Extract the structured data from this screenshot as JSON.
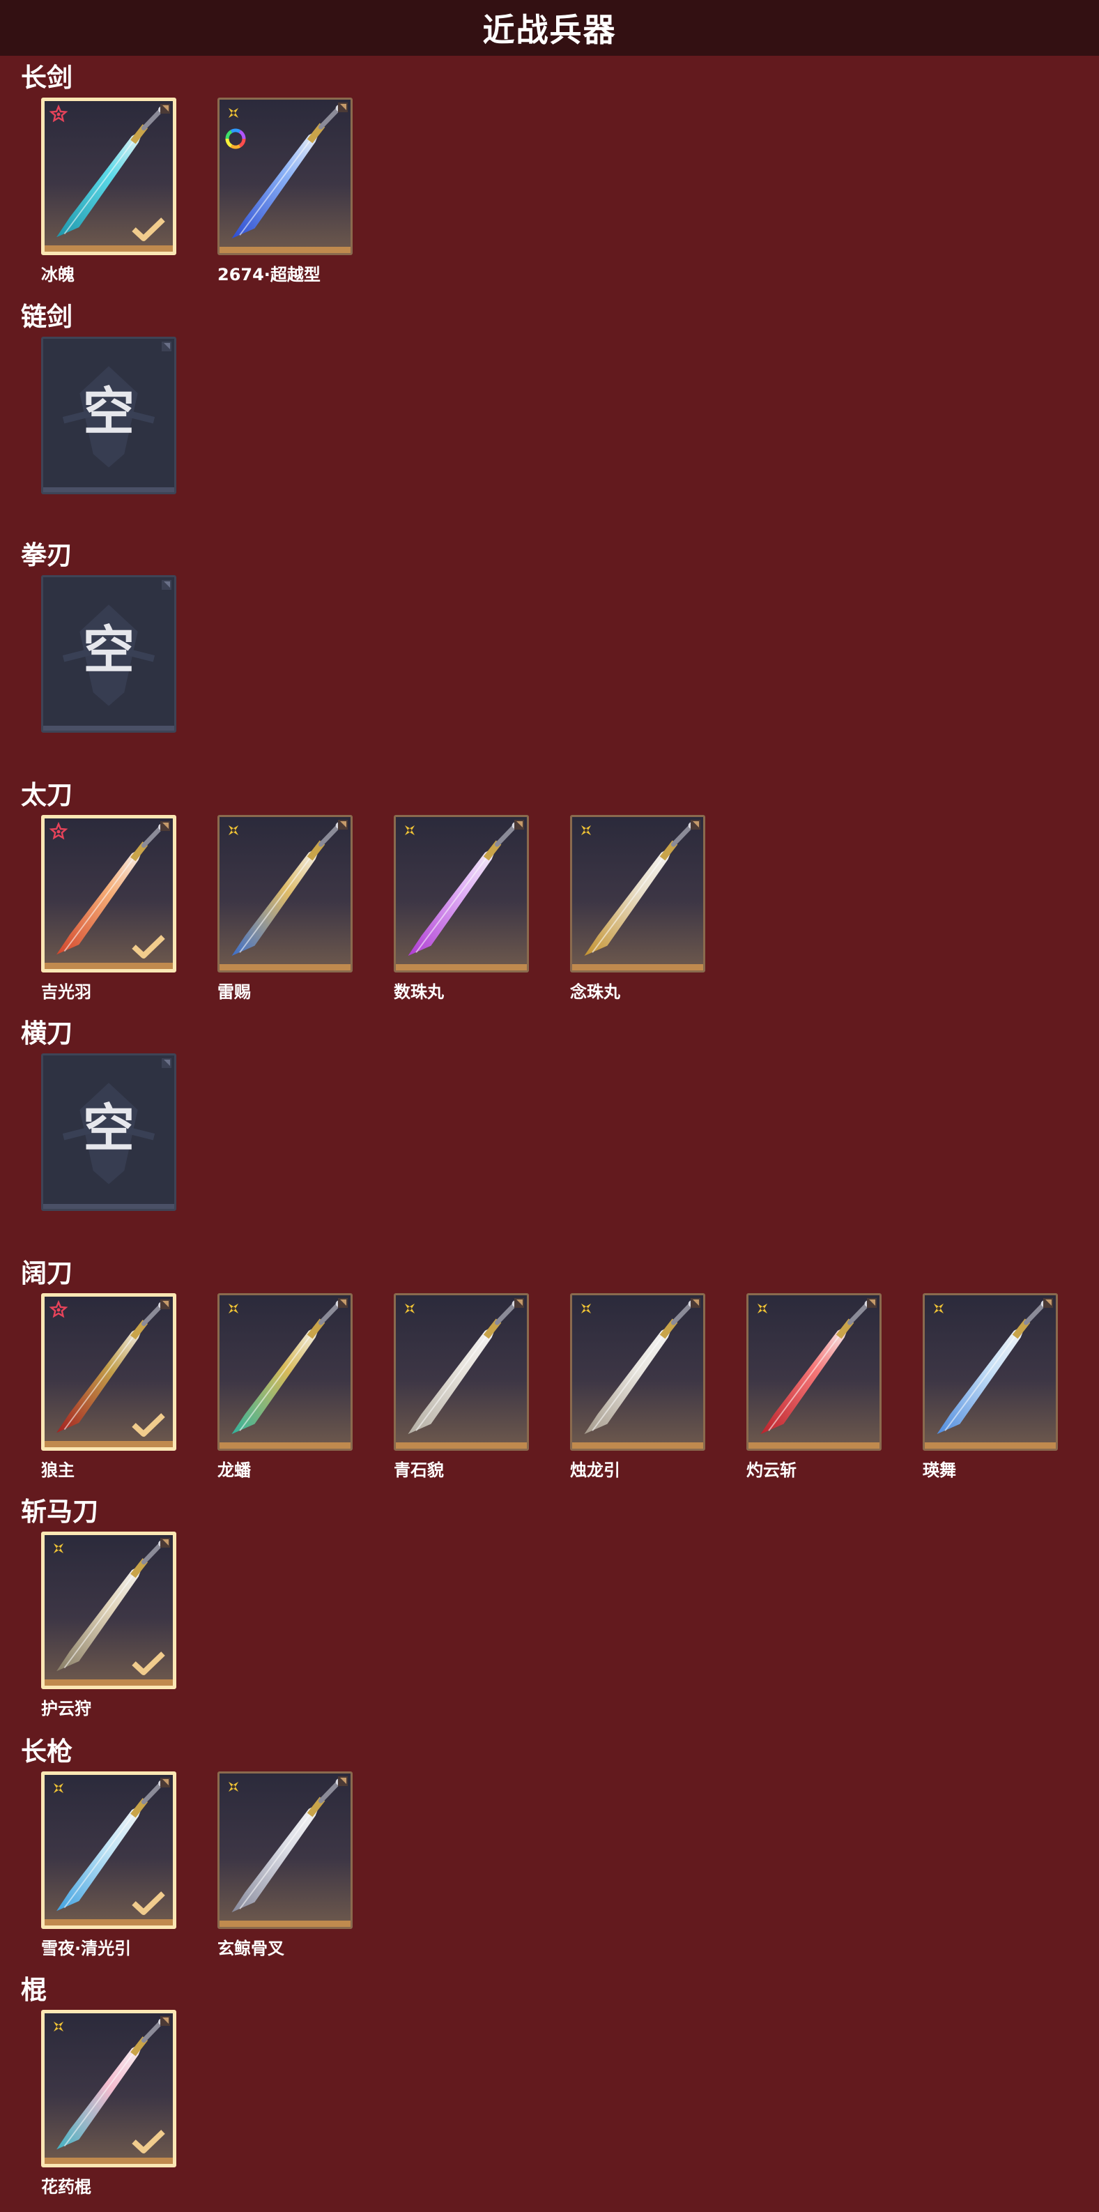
{
  "header": {
    "title": "近战兵器"
  },
  "categories": [
    {
      "label": "长剑",
      "items": [
        {
          "name": "冰魄",
          "rarity": "red",
          "selected": true,
          "colors": [
            "#5de2f0",
            "#1a9ab0"
          ]
        },
        {
          "name": "2674·超越型",
          "rarity": "gold",
          "selected": false,
          "colors": [
            "#8fb8ff",
            "#2a4cd8"
          ],
          "badge": "ring-icon"
        }
      ]
    },
    {
      "label": "链剑",
      "items": [
        {
          "name": "",
          "empty": true,
          "empty_text": "空"
        }
      ]
    },
    {
      "label": "拳刃",
      "items": [
        {
          "name": "",
          "empty": true,
          "empty_text": "空"
        }
      ]
    },
    {
      "label": "太刀",
      "items": [
        {
          "name": "吉光羽",
          "rarity": "red",
          "selected": true,
          "colors": [
            "#ffb47a",
            "#d8452a"
          ]
        },
        {
          "name": "雷赐",
          "rarity": "gold",
          "selected": false,
          "colors": [
            "#e7c26a",
            "#3a6fd0"
          ]
        },
        {
          "name": "数珠丸",
          "rarity": "gold",
          "selected": false,
          "colors": [
            "#e8b6ff",
            "#b23ad8"
          ]
        },
        {
          "name": "念珠丸",
          "rarity": "gold",
          "selected": false,
          "colors": [
            "#f1e7d0",
            "#c9962e"
          ]
        }
      ]
    },
    {
      "label": "横刀",
      "items": [
        {
          "name": "",
          "empty": true,
          "empty_text": "空"
        }
      ]
    },
    {
      "label": "阔刀",
      "items": [
        {
          "name": "狼主",
          "rarity": "red",
          "selected": true,
          "colors": [
            "#c9a44a",
            "#a81e1e"
          ]
        },
        {
          "name": "龙蟠",
          "rarity": "gold",
          "selected": false,
          "colors": [
            "#e0c15a",
            "#2fb7a0"
          ]
        },
        {
          "name": "青石貌",
          "rarity": "gold",
          "selected": false,
          "colors": [
            "#f0ece4",
            "#b8b3a8"
          ]
        },
        {
          "name": "烛龙引",
          "rarity": "gold",
          "selected": false,
          "colors": [
            "#f2efe8",
            "#a99f90"
          ]
        },
        {
          "name": "灼云斩",
          "rarity": "gold",
          "selected": false,
          "colors": [
            "#ff7a7a",
            "#c0202a"
          ]
        },
        {
          "name": "瑛舞",
          "rarity": "gold",
          "selected": false,
          "colors": [
            "#cfe9ff",
            "#4f8fe6"
          ]
        }
      ]
    },
    {
      "label": "斩马刀",
      "items": [
        {
          "name": "护云狩",
          "rarity": "gold",
          "selected": true,
          "colors": [
            "#e9dcc0",
            "#8a8068"
          ]
        }
      ]
    },
    {
      "label": "长枪",
      "items": [
        {
          "name": "雪夜·清光引",
          "rarity": "gold",
          "selected": true,
          "colors": [
            "#cbefff",
            "#3fa6e8"
          ]
        },
        {
          "name": "玄鲸骨叉",
          "rarity": "gold",
          "selected": false,
          "colors": [
            "#e4e6ee",
            "#8a8da0"
          ]
        }
      ]
    },
    {
      "label": "棍",
      "items": [
        {
          "name": "花药棍",
          "rarity": "gold",
          "selected": true,
          "colors": [
            "#ffc3d6",
            "#3fb7c8"
          ]
        }
      ]
    }
  ],
  "colors": {
    "background": "#631a1e",
    "header": "#331012",
    "selected_border": "#fbe7b4",
    "card_border": "#8a6a4e",
    "rarity_red": "#e8435a",
    "rarity_gold": "#f0c437",
    "check": "#f1cc8d"
  }
}
